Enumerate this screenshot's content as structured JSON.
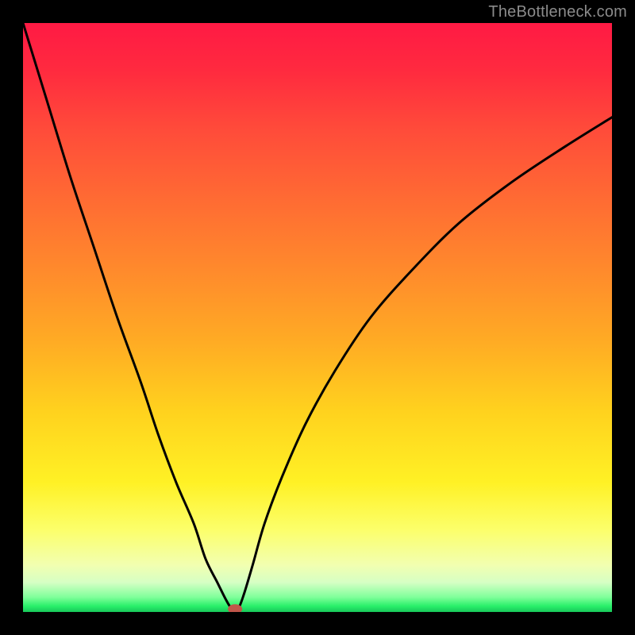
{
  "watermark": "TheBottleneck.com",
  "chart_data": {
    "type": "line",
    "title": "",
    "xlabel": "",
    "ylabel": "",
    "xlim": [
      0,
      100
    ],
    "ylim": [
      0,
      100
    ],
    "grid": false,
    "background_gradient": {
      "top": "#ff1a44",
      "mid_upper": "#ff8a2c",
      "mid": "#ffd21e",
      "mid_lower": "#fcff6a",
      "bottom": "#18c85a"
    },
    "series": [
      {
        "name": "bottleneck-curve",
        "x": [
          0,
          4,
          8,
          12,
          16,
          20,
          23,
          26,
          29,
          31,
          33,
          34.5,
          35.5,
          36.5,
          37.5,
          39,
          41,
          44,
          48,
          53,
          59,
          66,
          74,
          83,
          92,
          100
        ],
        "y": [
          100,
          87,
          74,
          62,
          50,
          39,
          30,
          22,
          15,
          9,
          5,
          2,
          0.5,
          0.5,
          3,
          8,
          15,
          23,
          32,
          41,
          50,
          58,
          66,
          73,
          79,
          84
        ]
      }
    ],
    "marker_point": {
      "x": 36,
      "y": 0.5
    },
    "marker_color": "#c0564a"
  }
}
